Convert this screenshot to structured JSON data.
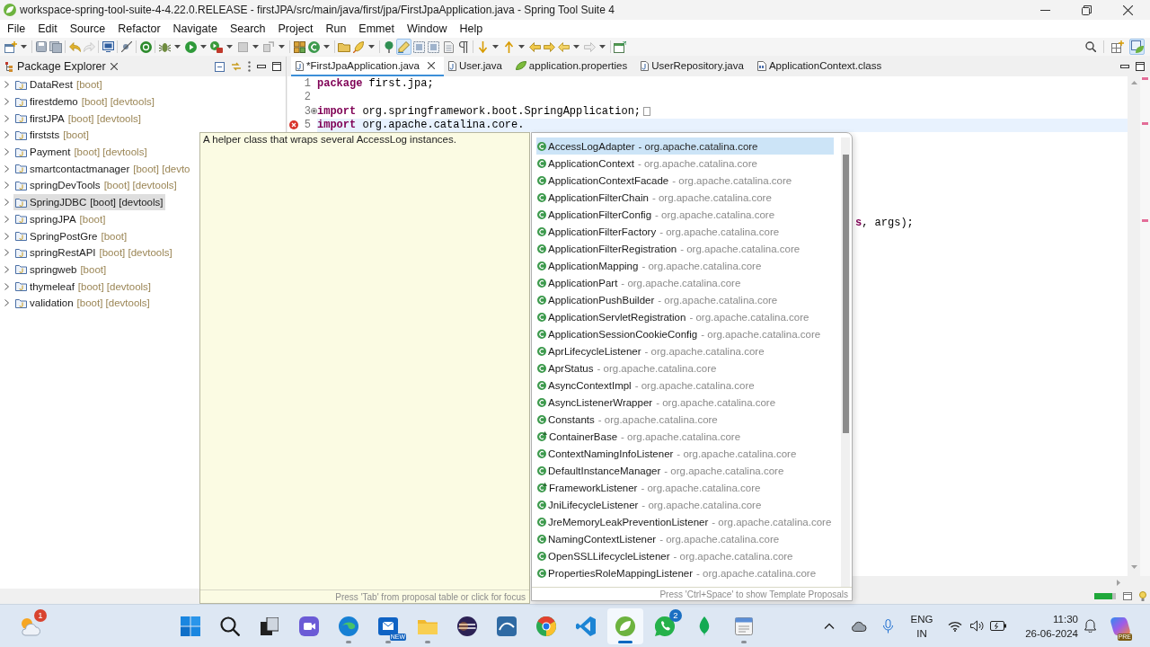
{
  "window": {
    "title": "workspace-spring-tool-suite-4-4.22.0.RELEASE - firstJPA/src/main/java/first/jpa/FirstJpaApplication.java - Spring Tool Suite 4"
  },
  "menu": [
    "File",
    "Edit",
    "Source",
    "Refactor",
    "Navigate",
    "Search",
    "Project",
    "Run",
    "Emmet",
    "Window",
    "Help"
  ],
  "toolbar": {
    "toggles": [
      {
        "pressed": true
      },
      {
        "pressed": false
      },
      {
        "pressed": false
      }
    ],
    "perspective": {
      "selected": true
    }
  },
  "package_explorer": {
    "title": "Package Explorer",
    "projects": [
      {
        "name": "DataRest",
        "decoration": "[boot]",
        "selected": false
      },
      {
        "name": "firestdemo",
        "decoration": "[boot] [devtools]",
        "selected": false
      },
      {
        "name": "firstJPA",
        "decoration": "[boot] [devtools]",
        "selected": false
      },
      {
        "name": "firststs",
        "decoration": "[boot]",
        "selected": false
      },
      {
        "name": "Payment",
        "decoration": "[boot] [devtools]",
        "selected": false
      },
      {
        "name": "smartcontactmanager",
        "decoration": "[boot] [devto",
        "selected": false
      },
      {
        "name": "springDevTools",
        "decoration": "[boot] [devtools]",
        "selected": false
      },
      {
        "name": "SpringJDBC",
        "decoration": "[boot] [devtools]",
        "selected": true
      },
      {
        "name": "springJPA",
        "decoration": "[boot]",
        "selected": false
      },
      {
        "name": "SpringPostGre",
        "decoration": "[boot]",
        "selected": false
      },
      {
        "name": "springRestAPI",
        "decoration": "[boot] [devtools]",
        "selected": false
      },
      {
        "name": "springweb",
        "decoration": "[boot]",
        "selected": false
      },
      {
        "name": "thymeleaf",
        "decoration": "[boot] [devtools]",
        "selected": false
      },
      {
        "name": "validation",
        "decoration": "[boot] [devtools]",
        "selected": false
      }
    ]
  },
  "editor": {
    "tabs": [
      {
        "label": "*FirstJpaApplication.java",
        "kind": "java",
        "selected": true
      },
      {
        "label": "User.java",
        "kind": "java",
        "selected": false
      },
      {
        "label": "application.properties",
        "kind": "properties",
        "selected": false
      },
      {
        "label": "UserRepository.java",
        "kind": "java",
        "selected": false
      },
      {
        "label": "ApplicationContext.class",
        "kind": "class",
        "selected": false
      }
    ],
    "lines": [
      {
        "number": "1",
        "folded": false,
        "error": false,
        "current": false,
        "tokens": [
          {
            "kind": "keyword",
            "text": "package"
          },
          {
            "kind": "plain",
            "text": " first.jpa;"
          }
        ]
      },
      {
        "number": "2",
        "folded": false,
        "error": false,
        "current": false
      },
      {
        "number": "3",
        "folded": true,
        "error": false,
        "current": false,
        "tokens": [
          {
            "kind": "keyword",
            "text": "import"
          },
          {
            "kind": "plain",
            "text": " org.springframework.boot.SpringApplication;"
          }
        ]
      },
      {
        "number": "5",
        "folded": false,
        "error": true,
        "current": true,
        "tokens": [
          {
            "kind": "keyword",
            "text": "import"
          },
          {
            "kind": "plain",
            "text": " org.apache.catalina.core."
          }
        ]
      }
    ],
    "partly_hidden_line": {
      "tokens": [
        {
          "kind": "keyword",
          "text": "s"
        },
        {
          "kind": "plain",
          "text": ", args);"
        }
      ]
    }
  },
  "javadoc_popup": {
    "text": "A helper class that wraps several AccessLog instances.",
    "hint": "Press 'Tab' from proposal table or click for focus"
  },
  "proposals": {
    "items": [
      {
        "kind": "class",
        "name": "AccessLogAdapter",
        "qualifier": "- org.apache.catalina.core",
        "selected": true
      },
      {
        "kind": "class",
        "name": "ApplicationContext",
        "qualifier": "- org.apache.catalina.core",
        "selected": false
      },
      {
        "kind": "class",
        "name": "ApplicationContextFacade",
        "qualifier": "- org.apache.catalina.core",
        "selected": false
      },
      {
        "kind": "class",
        "name": "ApplicationFilterChain",
        "qualifier": "- org.apache.catalina.core",
        "selected": false
      },
      {
        "kind": "class",
        "name": "ApplicationFilterConfig",
        "qualifier": "- org.apache.catalina.core",
        "selected": false
      },
      {
        "kind": "class",
        "name": "ApplicationFilterFactory",
        "qualifier": "- org.apache.catalina.core",
        "selected": false
      },
      {
        "kind": "class",
        "name": "ApplicationFilterRegistration",
        "qualifier": "- org.apache.catalina.core",
        "selected": false
      },
      {
        "kind": "class",
        "name": "ApplicationMapping",
        "qualifier": "- org.apache.catalina.core",
        "selected": false
      },
      {
        "kind": "class",
        "name": "ApplicationPart",
        "qualifier": "- org.apache.catalina.core",
        "selected": false
      },
      {
        "kind": "class",
        "name": "ApplicationPushBuilder",
        "qualifier": "- org.apache.catalina.core",
        "selected": false
      },
      {
        "kind": "class",
        "name": "ApplicationServletRegistration",
        "qualifier": "- org.apache.catalina.core",
        "selected": false
      },
      {
        "kind": "class",
        "name": "ApplicationSessionCookieConfig",
        "qualifier": "- org.apache.catalina.core",
        "selected": false
      },
      {
        "kind": "class",
        "name": "AprLifecycleListener",
        "qualifier": "- org.apache.catalina.core",
        "selected": false
      },
      {
        "kind": "class",
        "name": "AprStatus",
        "qualifier": "- org.apache.catalina.core",
        "selected": false
      },
      {
        "kind": "class",
        "name": "AsyncContextImpl",
        "qualifier": "- org.apache.catalina.core",
        "selected": false
      },
      {
        "kind": "class",
        "name": "AsyncListenerWrapper",
        "qualifier": "- org.apache.catalina.core",
        "selected": false
      },
      {
        "kind": "class",
        "name": "Constants",
        "qualifier": "- org.apache.catalina.core",
        "selected": false
      },
      {
        "kind": "abstract",
        "name": "ContainerBase",
        "qualifier": "- org.apache.catalina.core",
        "selected": false
      },
      {
        "kind": "class",
        "name": "ContextNamingInfoListener",
        "qualifier": "- org.apache.catalina.core",
        "selected": false
      },
      {
        "kind": "class",
        "name": "DefaultInstanceManager",
        "qualifier": "- org.apache.catalina.core",
        "selected": false
      },
      {
        "kind": "abstract",
        "name": "FrameworkListener",
        "qualifier": "- org.apache.catalina.core",
        "selected": false
      },
      {
        "kind": "class",
        "name": "JniLifecycleListener",
        "qualifier": "- org.apache.catalina.core",
        "selected": false
      },
      {
        "kind": "class",
        "name": "JreMemoryLeakPreventionListener",
        "qualifier": "- org.apache.catalina.core",
        "selected": false
      },
      {
        "kind": "class",
        "name": "NamingContextListener",
        "qualifier": "- org.apache.catalina.core",
        "selected": false
      },
      {
        "kind": "class",
        "name": "OpenSSLLifecycleListener",
        "qualifier": "- org.apache.catalina.core",
        "selected": false
      },
      {
        "kind": "class",
        "name": "PropertiesRoleMappingListener",
        "qualifier": "- org.apache.catalina.core",
        "selected": false
      }
    ],
    "hint": "Press 'Ctrl+Space' to show Template Proposals"
  },
  "taskbar": {
    "weather": {
      "badge": "1"
    },
    "apps": [
      {
        "kind": "start",
        "running": false,
        "selected": false
      },
      {
        "kind": "search",
        "running": false,
        "selected": false
      },
      {
        "kind": "task-view",
        "running": false,
        "selected": false
      },
      {
        "kind": "meet",
        "running": false,
        "selected": false
      },
      {
        "kind": "edge",
        "running": true,
        "selected": false
      },
      {
        "kind": "outlook",
        "tag": "NEW",
        "running": true,
        "selected": false
      },
      {
        "kind": "explorer",
        "running": true,
        "selected": false
      },
      {
        "kind": "eclipse",
        "running": false,
        "selected": false
      },
      {
        "kind": "workbench",
        "running": false,
        "selected": false
      },
      {
        "kind": "chrome",
        "running": false,
        "selected": false
      },
      {
        "kind": "vscode",
        "running": false,
        "selected": false
      },
      {
        "kind": "sts",
        "running": true,
        "selected": true
      },
      {
        "kind": "whatsapp",
        "badge": "2",
        "running": false,
        "selected": false
      },
      {
        "kind": "mongodb",
        "running": false,
        "selected": false
      },
      {
        "kind": "viewer",
        "running": true,
        "selected": false
      }
    ],
    "tray": {
      "language": "ENG",
      "region": "IN",
      "time": "11:30",
      "date": "26-06-2024",
      "copilot_tag": "PRE"
    }
  }
}
